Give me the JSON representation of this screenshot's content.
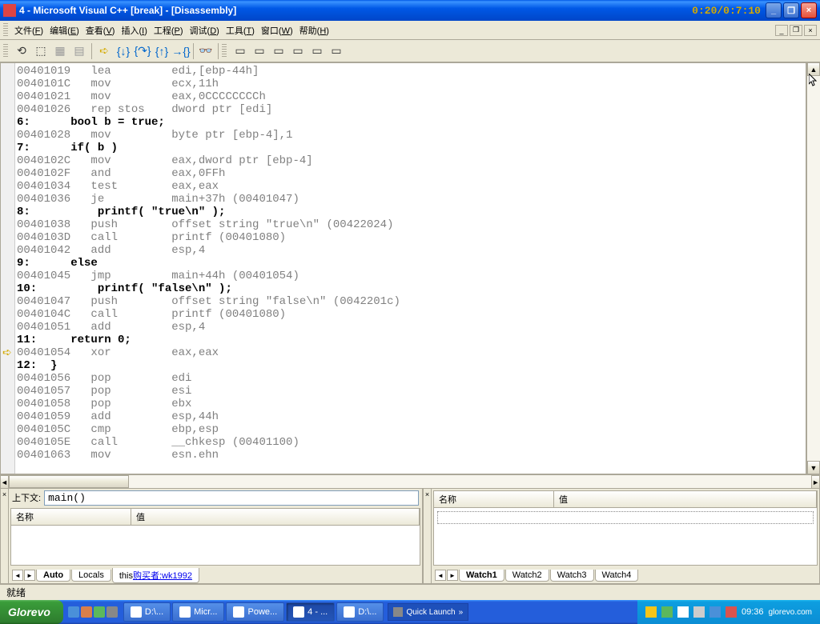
{
  "title": "4 - Microsoft Visual C++ [break] - [Disassembly]",
  "time_overlay": "0:20/0:7:10",
  "menu": [
    {
      "label": "文件",
      "accel": "F"
    },
    {
      "label": "编辑",
      "accel": "E"
    },
    {
      "label": "查看",
      "accel": "V"
    },
    {
      "label": "插入",
      "accel": "I"
    },
    {
      "label": "工程",
      "accel": "P"
    },
    {
      "label": "调试",
      "accel": "D"
    },
    {
      "label": "工具",
      "accel": "T"
    },
    {
      "label": "窗口",
      "accel": "W"
    },
    {
      "label": "帮助",
      "accel": "H"
    }
  ],
  "code_lines": [
    {
      "addr": "00401019",
      "instr": "lea",
      "ops": "edi,[ebp-44h]"
    },
    {
      "addr": "0040101C",
      "instr": "mov",
      "ops": "ecx,11h"
    },
    {
      "addr": "00401021",
      "instr": "mov",
      "ops": "eax,0CCCCCCCCh"
    },
    {
      "addr": "00401026",
      "instr": "rep stos",
      "ops": "dword ptr [edi]"
    },
    {
      "src": "6:      bool b = true;"
    },
    {
      "addr": "00401028",
      "instr": "mov",
      "ops": "byte ptr [ebp-4],1"
    },
    {
      "src": "7:      if( b )"
    },
    {
      "addr": "0040102C",
      "instr": "mov",
      "ops": "eax,dword ptr [ebp-4]"
    },
    {
      "addr": "0040102F",
      "instr": "and",
      "ops": "eax,0FFh"
    },
    {
      "addr": "00401034",
      "instr": "test",
      "ops": "eax,eax"
    },
    {
      "addr": "00401036",
      "instr": "je",
      "ops": "main+37h (00401047)"
    },
    {
      "src": "8:          printf( \"true\\n\" );"
    },
    {
      "addr": "00401038",
      "instr": "push",
      "ops": "offset string \"true\\n\" (00422024)"
    },
    {
      "addr": "0040103D",
      "instr": "call",
      "ops": "printf (00401080)"
    },
    {
      "addr": "00401042",
      "instr": "add",
      "ops": "esp,4"
    },
    {
      "src": "9:      else"
    },
    {
      "addr": "00401045",
      "instr": "jmp",
      "ops": "main+44h (00401054)"
    },
    {
      "src": "10:         printf( \"false\\n\" );"
    },
    {
      "addr": "00401047",
      "instr": "push",
      "ops": "offset string \"false\\n\" (0042201c)"
    },
    {
      "addr": "0040104C",
      "instr": "call",
      "ops": "printf (00401080)"
    },
    {
      "addr": "00401051",
      "instr": "add",
      "ops": "esp,4"
    },
    {
      "src": "11:     return 0;"
    },
    {
      "addr": "00401054",
      "instr": "xor",
      "ops": "eax,eax",
      "current": true
    },
    {
      "src": "12:  }"
    },
    {
      "addr": "00401056",
      "instr": "pop",
      "ops": "edi"
    },
    {
      "addr": "00401057",
      "instr": "pop",
      "ops": "esi"
    },
    {
      "addr": "00401058",
      "instr": "pop",
      "ops": "ebx"
    },
    {
      "addr": "00401059",
      "instr": "add",
      "ops": "esp,44h"
    },
    {
      "addr": "0040105C",
      "instr": "cmp",
      "ops": "ebp,esp"
    },
    {
      "addr": "0040105E",
      "instr": "call",
      "ops": "__chkesp (00401100)"
    },
    {
      "addr": "00401063",
      "instr": "mov",
      "ops": "esn.ehn"
    }
  ],
  "left_panel": {
    "context_label": "上下文:",
    "context_value": "main()",
    "col_name": "名称",
    "col_value": "值",
    "tabs": [
      "Auto",
      "Locals",
      "this"
    ],
    "active_tab": "Auto",
    "link_text": "购买者:wk1992"
  },
  "right_panel": {
    "col_name": "名称",
    "col_value": "值",
    "tabs": [
      "Watch1",
      "Watch2",
      "Watch3",
      "Watch4"
    ],
    "active_tab": "Watch1"
  },
  "statusbar": "就绪",
  "taskbar": {
    "start": "Glorevo",
    "items": [
      {
        "label": "D:\\..."
      },
      {
        "label": "Micr..."
      },
      {
        "label": "Powe..."
      },
      {
        "label": "4 - ...",
        "active": true
      },
      {
        "label": "D:\\..."
      }
    ],
    "quicklaunch": "Quick Launch",
    "time": "09:36",
    "brand": "glorevo.com"
  }
}
